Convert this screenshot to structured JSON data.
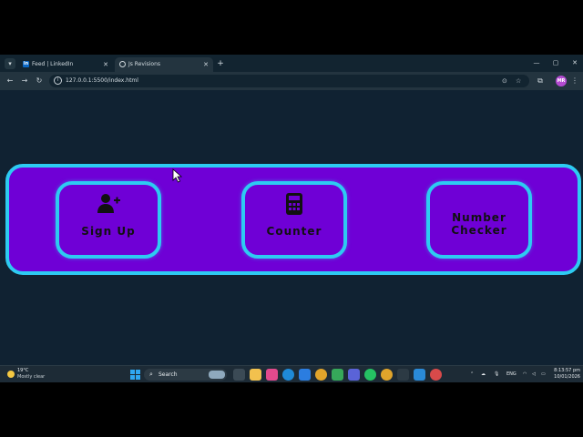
{
  "browser": {
    "tabs": [
      {
        "title": "Feed | LinkedIn",
        "favicon": "linkedin-icon",
        "active": false
      },
      {
        "title": "Js Revisions",
        "favicon": "globe-icon",
        "active": true
      }
    ],
    "url": "127.0.0.1:5500/index.html",
    "profile_initials": "MR",
    "colors": {
      "frame": "#122430",
      "toolbar": "#23343f"
    }
  },
  "page": {
    "background": "#102232",
    "accent": "#2dcbf2",
    "panel_color": "#6f00d6",
    "cards": [
      {
        "label": "Sign Up",
        "icon": "user-plus-icon"
      },
      {
        "label": "Counter",
        "icon": "calculator-icon"
      },
      {
        "label_lines": [
          "Number",
          "Checker"
        ],
        "icon": null
      }
    ]
  },
  "taskbar": {
    "weather": {
      "temp": "19°C",
      "condition": "Mostly clear"
    },
    "search_label": "Search",
    "language": "ENG",
    "time": "8:13:57 pm",
    "date": "10/01/2026"
  }
}
